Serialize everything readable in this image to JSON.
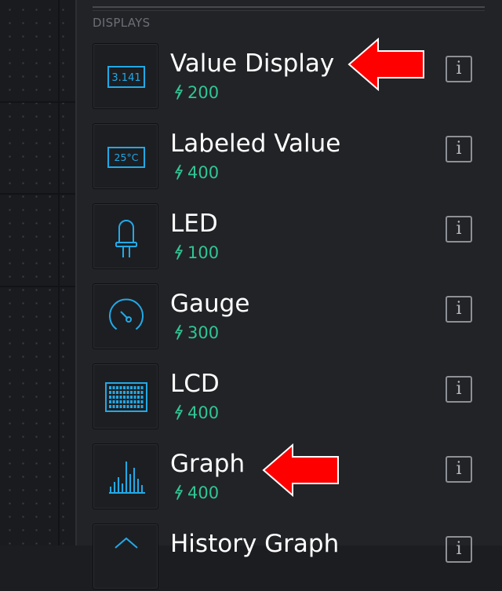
{
  "section": {
    "label": "DISPLAYS"
  },
  "widgets": [
    {
      "name": "Value Display",
      "cost": "200",
      "icon": "value-display-icon",
      "icon_text": "3.141"
    },
    {
      "name": "Labeled Value",
      "cost": "400",
      "icon": "labeled-value-icon",
      "icon_text": "25°C"
    },
    {
      "name": "LED",
      "cost": "100",
      "icon": "led-icon"
    },
    {
      "name": "Gauge",
      "cost": "300",
      "icon": "gauge-icon"
    },
    {
      "name": "LCD",
      "cost": "400",
      "icon": "lcd-icon"
    },
    {
      "name": "Graph",
      "cost": "400",
      "icon": "graph-icon"
    },
    {
      "name": "History Graph",
      "cost": "",
      "icon": "history-graph-icon"
    }
  ],
  "info_label": "i",
  "annotations": [
    {
      "target": "Value Display",
      "shape": "red-arrow-left"
    },
    {
      "target": "Graph",
      "shape": "red-arrow-left"
    }
  ],
  "colors": {
    "background": "#1c1d21",
    "panel": "#222327",
    "accent_blue": "#22a9e6",
    "energy_green": "#2fc693",
    "annotation_red": "#ff0000"
  }
}
